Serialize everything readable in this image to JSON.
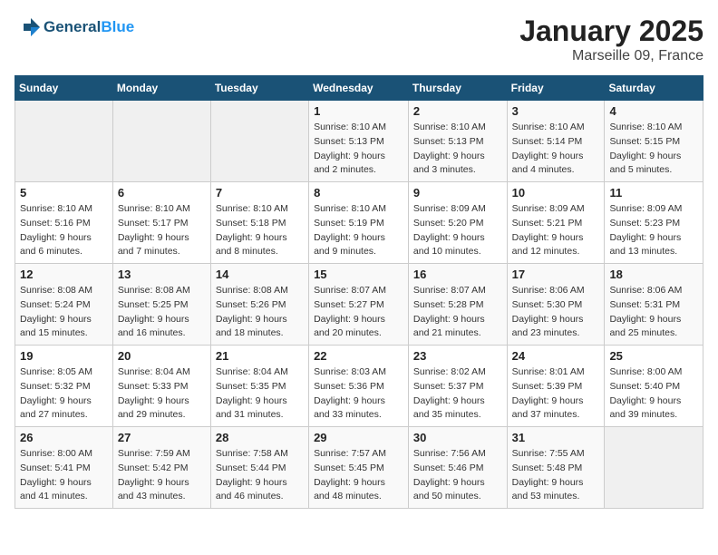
{
  "header": {
    "logo_line1": "General",
    "logo_line2": "Blue",
    "title": "January 2025",
    "subtitle": "Marseille 09, France"
  },
  "days_of_week": [
    "Sunday",
    "Monday",
    "Tuesday",
    "Wednesday",
    "Thursday",
    "Friday",
    "Saturday"
  ],
  "weeks": [
    [
      {
        "day": "",
        "info": ""
      },
      {
        "day": "",
        "info": ""
      },
      {
        "day": "",
        "info": ""
      },
      {
        "day": "1",
        "info": "Sunrise: 8:10 AM\nSunset: 5:13 PM\nDaylight: 9 hours and 2 minutes."
      },
      {
        "day": "2",
        "info": "Sunrise: 8:10 AM\nSunset: 5:13 PM\nDaylight: 9 hours and 3 minutes."
      },
      {
        "day": "3",
        "info": "Sunrise: 8:10 AM\nSunset: 5:14 PM\nDaylight: 9 hours and 4 minutes."
      },
      {
        "day": "4",
        "info": "Sunrise: 8:10 AM\nSunset: 5:15 PM\nDaylight: 9 hours and 5 minutes."
      }
    ],
    [
      {
        "day": "5",
        "info": "Sunrise: 8:10 AM\nSunset: 5:16 PM\nDaylight: 9 hours and 6 minutes."
      },
      {
        "day": "6",
        "info": "Sunrise: 8:10 AM\nSunset: 5:17 PM\nDaylight: 9 hours and 7 minutes."
      },
      {
        "day": "7",
        "info": "Sunrise: 8:10 AM\nSunset: 5:18 PM\nDaylight: 9 hours and 8 minutes."
      },
      {
        "day": "8",
        "info": "Sunrise: 8:10 AM\nSunset: 5:19 PM\nDaylight: 9 hours and 9 minutes."
      },
      {
        "day": "9",
        "info": "Sunrise: 8:09 AM\nSunset: 5:20 PM\nDaylight: 9 hours and 10 minutes."
      },
      {
        "day": "10",
        "info": "Sunrise: 8:09 AM\nSunset: 5:21 PM\nDaylight: 9 hours and 12 minutes."
      },
      {
        "day": "11",
        "info": "Sunrise: 8:09 AM\nSunset: 5:23 PM\nDaylight: 9 hours and 13 minutes."
      }
    ],
    [
      {
        "day": "12",
        "info": "Sunrise: 8:08 AM\nSunset: 5:24 PM\nDaylight: 9 hours and 15 minutes."
      },
      {
        "day": "13",
        "info": "Sunrise: 8:08 AM\nSunset: 5:25 PM\nDaylight: 9 hours and 16 minutes."
      },
      {
        "day": "14",
        "info": "Sunrise: 8:08 AM\nSunset: 5:26 PM\nDaylight: 9 hours and 18 minutes."
      },
      {
        "day": "15",
        "info": "Sunrise: 8:07 AM\nSunset: 5:27 PM\nDaylight: 9 hours and 20 minutes."
      },
      {
        "day": "16",
        "info": "Sunrise: 8:07 AM\nSunset: 5:28 PM\nDaylight: 9 hours and 21 minutes."
      },
      {
        "day": "17",
        "info": "Sunrise: 8:06 AM\nSunset: 5:30 PM\nDaylight: 9 hours and 23 minutes."
      },
      {
        "day": "18",
        "info": "Sunrise: 8:06 AM\nSunset: 5:31 PM\nDaylight: 9 hours and 25 minutes."
      }
    ],
    [
      {
        "day": "19",
        "info": "Sunrise: 8:05 AM\nSunset: 5:32 PM\nDaylight: 9 hours and 27 minutes."
      },
      {
        "day": "20",
        "info": "Sunrise: 8:04 AM\nSunset: 5:33 PM\nDaylight: 9 hours and 29 minutes."
      },
      {
        "day": "21",
        "info": "Sunrise: 8:04 AM\nSunset: 5:35 PM\nDaylight: 9 hours and 31 minutes."
      },
      {
        "day": "22",
        "info": "Sunrise: 8:03 AM\nSunset: 5:36 PM\nDaylight: 9 hours and 33 minutes."
      },
      {
        "day": "23",
        "info": "Sunrise: 8:02 AM\nSunset: 5:37 PM\nDaylight: 9 hours and 35 minutes."
      },
      {
        "day": "24",
        "info": "Sunrise: 8:01 AM\nSunset: 5:39 PM\nDaylight: 9 hours and 37 minutes."
      },
      {
        "day": "25",
        "info": "Sunrise: 8:00 AM\nSunset: 5:40 PM\nDaylight: 9 hours and 39 minutes."
      }
    ],
    [
      {
        "day": "26",
        "info": "Sunrise: 8:00 AM\nSunset: 5:41 PM\nDaylight: 9 hours and 41 minutes."
      },
      {
        "day": "27",
        "info": "Sunrise: 7:59 AM\nSunset: 5:42 PM\nDaylight: 9 hours and 43 minutes."
      },
      {
        "day": "28",
        "info": "Sunrise: 7:58 AM\nSunset: 5:44 PM\nDaylight: 9 hours and 46 minutes."
      },
      {
        "day": "29",
        "info": "Sunrise: 7:57 AM\nSunset: 5:45 PM\nDaylight: 9 hours and 48 minutes."
      },
      {
        "day": "30",
        "info": "Sunrise: 7:56 AM\nSunset: 5:46 PM\nDaylight: 9 hours and 50 minutes."
      },
      {
        "day": "31",
        "info": "Sunrise: 7:55 AM\nSunset: 5:48 PM\nDaylight: 9 hours and 53 minutes."
      },
      {
        "day": "",
        "info": ""
      }
    ]
  ]
}
